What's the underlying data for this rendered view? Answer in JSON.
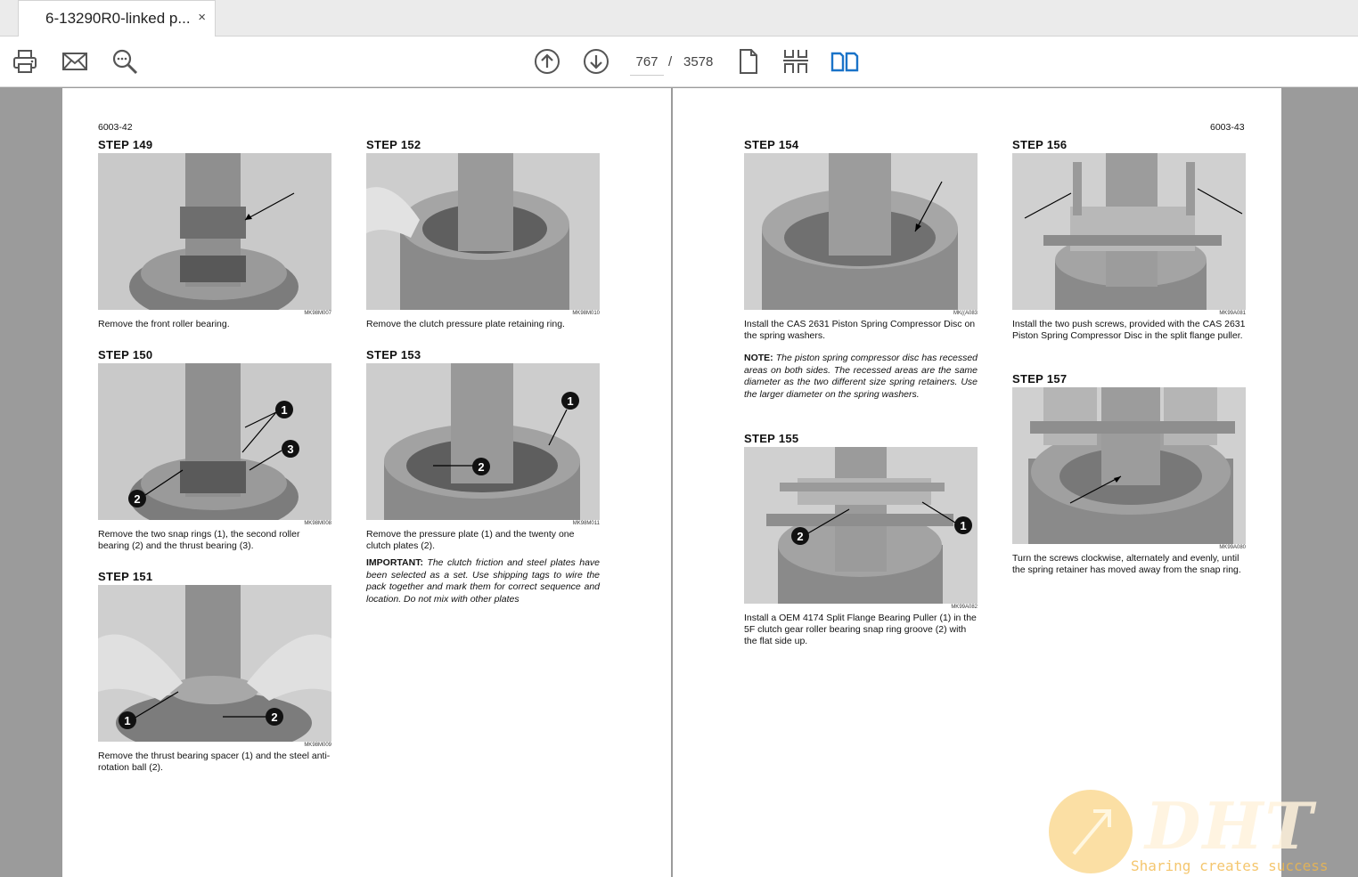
{
  "tab": {
    "title": "6-13290R0-linked p...",
    "close": "×"
  },
  "toolbar": {
    "icons": [
      "print-icon",
      "email-icon",
      "find-icon",
      "page-up-icon",
      "page-down-icon",
      "single-page-icon",
      "thumbnails-icon",
      "two-page-icon"
    ],
    "current_page": "767",
    "separator": "/",
    "total_pages": "3578",
    "accent": "#1a73c8"
  },
  "left_page": {
    "number": "6003-42",
    "steps": [
      {
        "title": "STEP  149",
        "code": "MK98M007",
        "caption": "Remove the front roller bearing."
      },
      {
        "title": "STEP  150",
        "code": "MK98M008",
        "caption": "Remove the two snap rings (1), the second roller bearing (2) and the thrust bearing (3)."
      },
      {
        "title": "STEP  151",
        "code": "MK98M009",
        "caption": "Remove the thrust bearing spacer (1) and the steel anti-rotation ball (2)."
      },
      {
        "title": "STEP  152",
        "code": "MK98M010",
        "caption": "Remove the clutch pressure plate retaining ring."
      },
      {
        "title": "STEP  153",
        "code": "MK98M011",
        "caption": "Remove the pressure plate (1) and the twenty one clutch plates (2).",
        "note_label": "IMPORTANT:",
        "note": " The clutch friction and steel plates have been selected as a set. Use shipping tags to wire the pack together and mark them for correct sequence and location. Do not mix with other plates"
      }
    ]
  },
  "right_page": {
    "number": "6003-43",
    "steps": [
      {
        "title": "STEP  154",
        "code": "MK((A083",
        "caption": "Install the CAS 2631 Piston Spring Compressor Disc on the spring washers.",
        "note_label": "NOTE:",
        "note": " The piston spring compressor disc has recessed areas on both sides. The recessed areas are the same diameter as the two different size spring retainers. Use the larger diameter on the spring washers."
      },
      {
        "title": "STEP  155",
        "code": "MK99A082",
        "caption": "Install a OEM 4174 Split Flange Bearing Puller (1) in the 5F clutch gear roller bearing snap ring groove (2) with the flat side up."
      },
      {
        "title": "STEP  156",
        "code": "MK99A081",
        "caption": "Install the two push screws, provided with the CAS 2631 Piston Spring Compressor Disc in the split flange puller."
      },
      {
        "title": "STEP  157",
        "code": "MK99A080",
        "caption": "Turn the screws clockwise, alternately and evenly, until the spring retainer has moved away from the snap ring."
      }
    ]
  },
  "callouts": {
    "one": "1",
    "two": "2",
    "three": "3"
  },
  "watermark": {
    "logo": "DHT",
    "tagline": "Sharing creates success"
  }
}
